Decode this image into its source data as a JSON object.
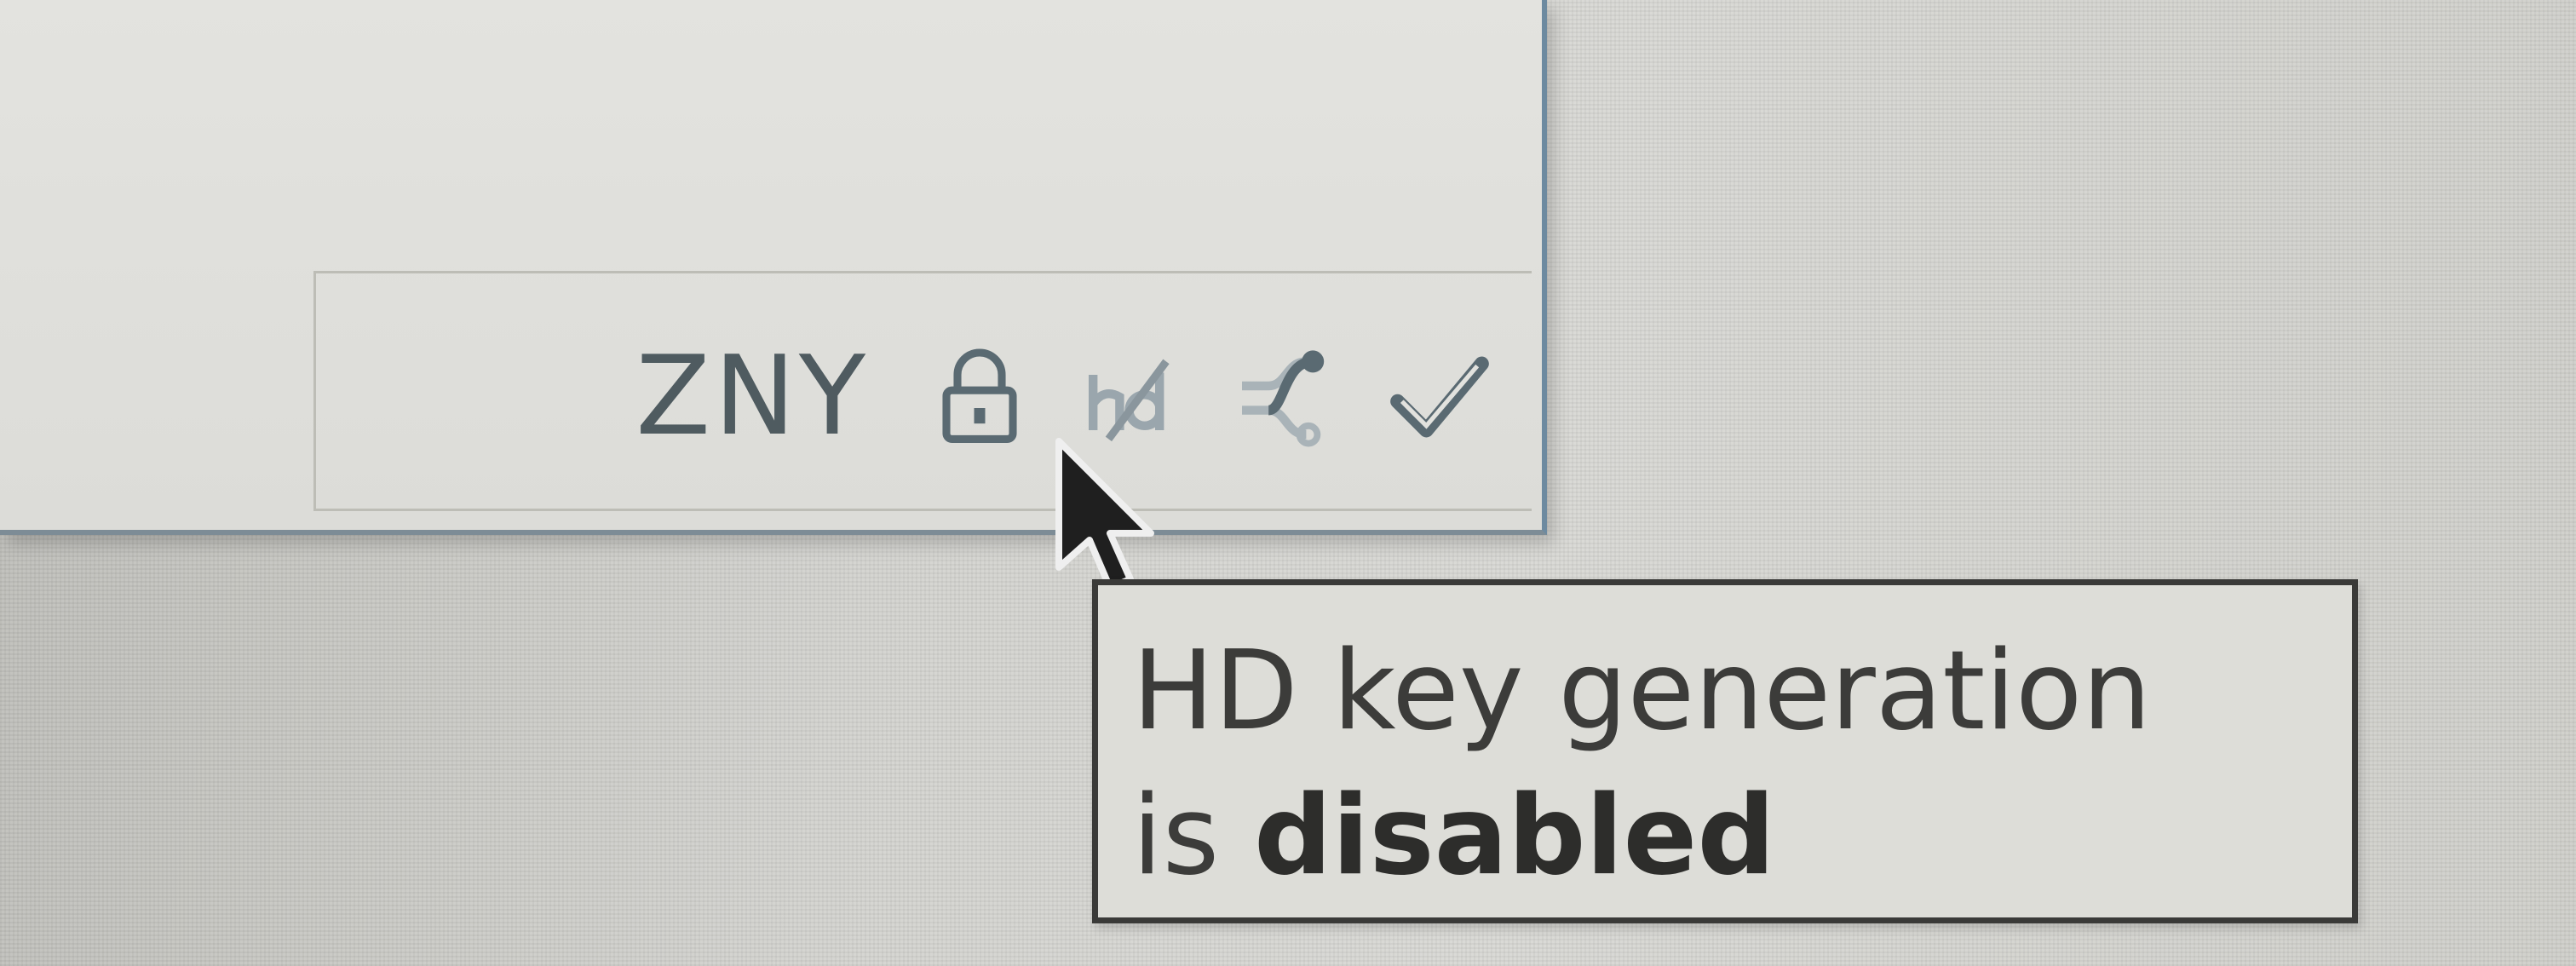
{
  "status_bar": {
    "unit": "ZNY",
    "icons": [
      {
        "name": "lock-icon",
        "state": "wallet unlocked"
      },
      {
        "name": "hd-key-disabled-icon",
        "state": "disabled"
      },
      {
        "name": "network-connections-icon",
        "state": "connected"
      },
      {
        "name": "sync-check-icon",
        "state": "synced"
      }
    ]
  },
  "tooltip": {
    "line1": "HD key generation",
    "line2_prefix": "is ",
    "line2_emphasis": "disabled"
  },
  "colors": {
    "icon": "#5a6a72",
    "icon_disabled": "#9aa6ad",
    "tooltip_border": "#3a3a38",
    "window_edge": "#6d8aa0"
  }
}
